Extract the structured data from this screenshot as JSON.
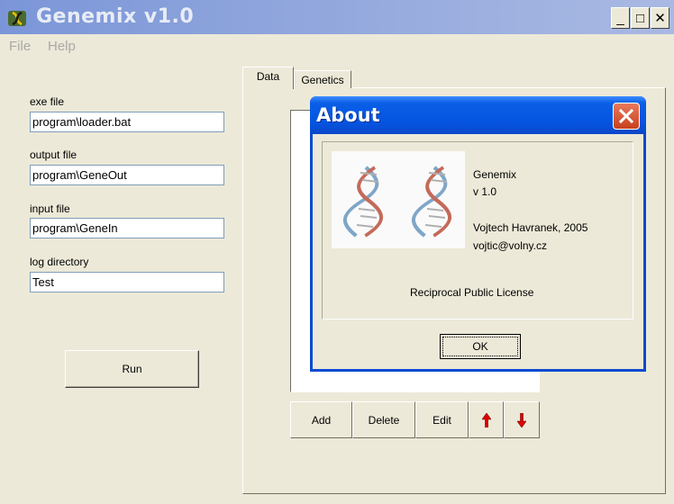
{
  "window": {
    "title": "Genemix v1.0",
    "controls": {
      "minimize": "_",
      "maximize": "□",
      "close": "✕"
    }
  },
  "menu": {
    "items": [
      "File",
      "Help"
    ]
  },
  "form": {
    "exe_label": "exe file",
    "exe_value": "program\\loader.bat",
    "output_label": "output file",
    "output_value": "program\\GeneOut",
    "input_label": "input file",
    "input_value": "program\\GeneIn",
    "log_label": "log directory",
    "log_value": "Test",
    "run_label": "Run"
  },
  "tabs": [
    "Data",
    "Genetics"
  ],
  "data_toolbar": {
    "add_label": "Add",
    "delete_label": "Delete",
    "edit_label": "Edit",
    "up_icon": "up-arrow",
    "down_icon": "down-arrow"
  },
  "about": {
    "title": "About",
    "app_name": "Genemix",
    "version": "v 1.0",
    "author": "Vojtech Havranek, 2005",
    "email": "vojtic@volny.cz",
    "license": "Reciprocal Public License",
    "ok_label": "OK",
    "image": "dna-double-helix"
  },
  "colors": {
    "window_bg": "#ece9d8",
    "inactive_title": "#98acde",
    "dialog_title": "#0554e1",
    "close_button": "#d4582f",
    "arrow": "#e00000"
  }
}
